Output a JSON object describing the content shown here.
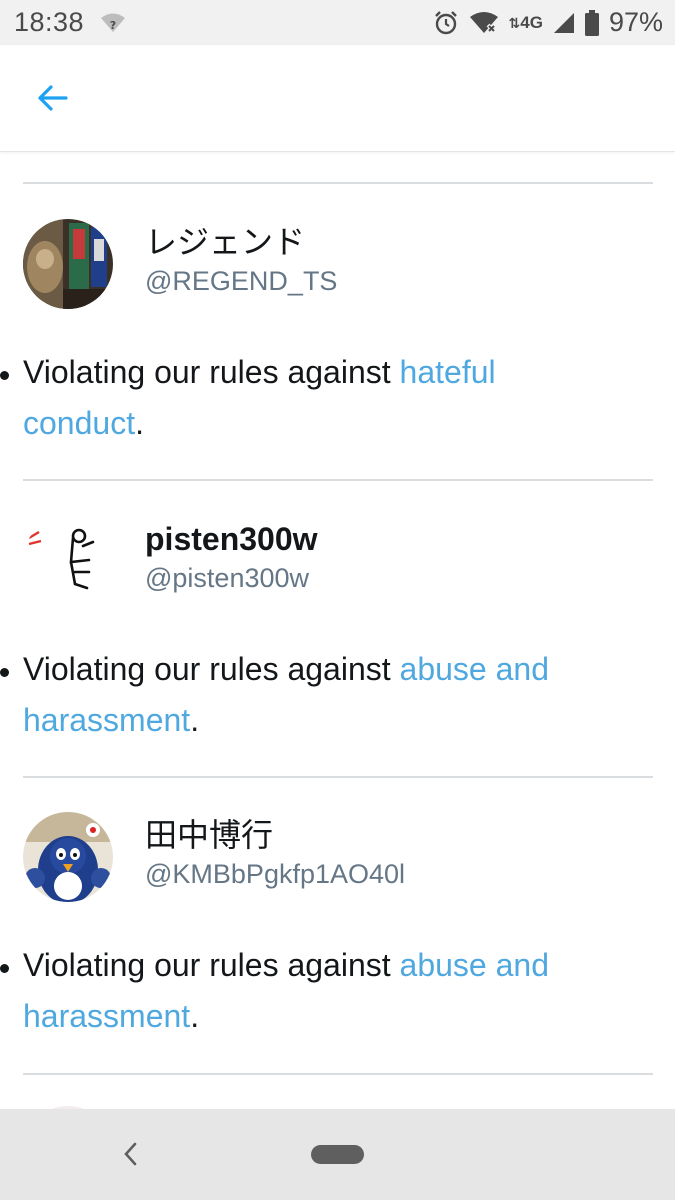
{
  "status_bar": {
    "time": "18:38",
    "network": "4G",
    "battery": "97%",
    "icons": [
      "wifi-question-icon",
      "alarm-icon",
      "wifi-off-icon",
      "signal-icon",
      "battery-icon"
    ]
  },
  "app_bar": {
    "back_icon": "arrow-left-icon",
    "accent_color": "#1da1f2"
  },
  "accounts": [
    {
      "display_name": "レジェンド",
      "handle": "@REGEND_TS",
      "rule_prefix": "Violating our rules against ",
      "rule_link": "hateful conduct",
      "rule_suffix": "."
    },
    {
      "display_name": "pisten300w",
      "handle": "@pisten300w",
      "rule_prefix": "Violating our rules against ",
      "rule_link": "abuse and harassment",
      "rule_suffix": "."
    },
    {
      "display_name": "田中博行",
      "handle": "@KMBbPgkfp1AO40l",
      "rule_prefix": "Violating our rules against ",
      "rule_link": "abuse and harassment",
      "rule_suffix": "."
    }
  ],
  "nav_bar": {
    "back_icon": "chevron-left-icon",
    "home_icon": "home-pill-icon"
  },
  "colors": {
    "link": "#4fa8e0",
    "text": "#14171a",
    "secondary": "#657786",
    "divider": "#d9dde0"
  }
}
